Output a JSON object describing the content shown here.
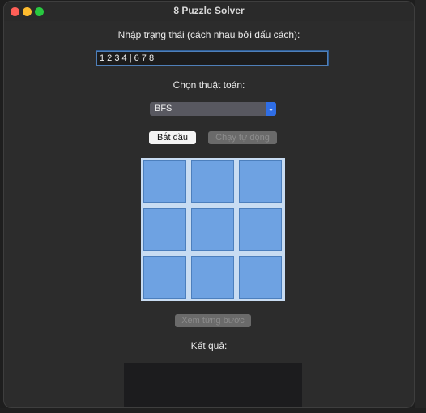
{
  "window": {
    "title": "8 Puzzle Solver"
  },
  "input": {
    "label": "Nhập trạng thái (cách nhau bởi dấu cách):",
    "value": "1 2 3 4 | 6 7 8"
  },
  "algorithm": {
    "label": "Chọn thuật toán:",
    "selected": "BFS"
  },
  "buttons": {
    "start": "Bắt đầu",
    "auto": "Chạy tự động",
    "step": "Xem từng bước"
  },
  "board": {
    "tiles": [
      "",
      "",
      "",
      "",
      "",
      "",
      "",
      "",
      ""
    ]
  },
  "result": {
    "label": "Kết quả:",
    "text": ""
  },
  "colors": {
    "tile": "#6ea2e2",
    "accent": "#2f6ee6"
  }
}
